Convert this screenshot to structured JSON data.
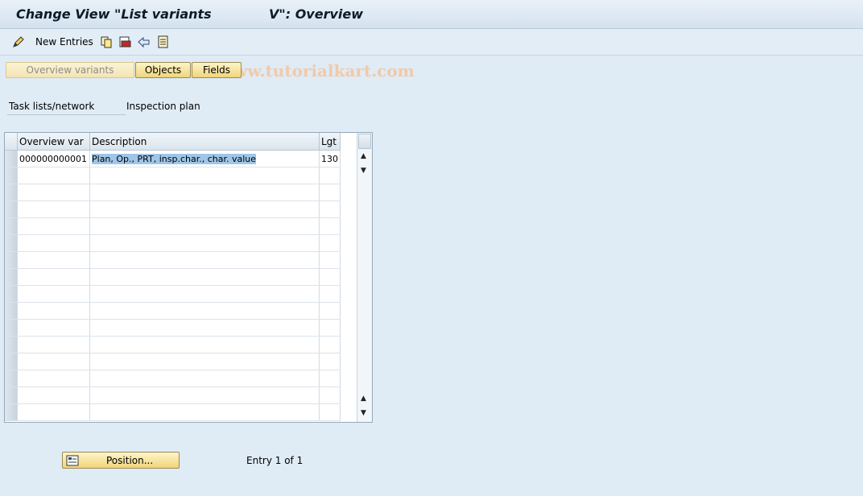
{
  "title": {
    "left": "Change View \"List variants",
    "right": "V\": Overview"
  },
  "toolbar": {
    "new_entries": "New Entries",
    "watermark": "© www.tutorialkart.com"
  },
  "buttons": {
    "overview_variants": "Overview variants",
    "objects": "Objects",
    "fields": "Fields",
    "position": "Position..."
  },
  "context": {
    "label": "Task lists/network",
    "value": "Inspection plan"
  },
  "table": {
    "columns": [
      "Overview var",
      "Description",
      "Lgt"
    ],
    "rows": [
      {
        "overview_var": "000000000001",
        "description": "Plan, Op., PRT, insp.char., char. value",
        "lgt": "130"
      }
    ]
  },
  "footer": {
    "entry": "Entry 1 of 1"
  },
  "colors": {
    "accent": "#f0d57a",
    "background": "#dfebf5",
    "selection": "#9fc5e8"
  }
}
